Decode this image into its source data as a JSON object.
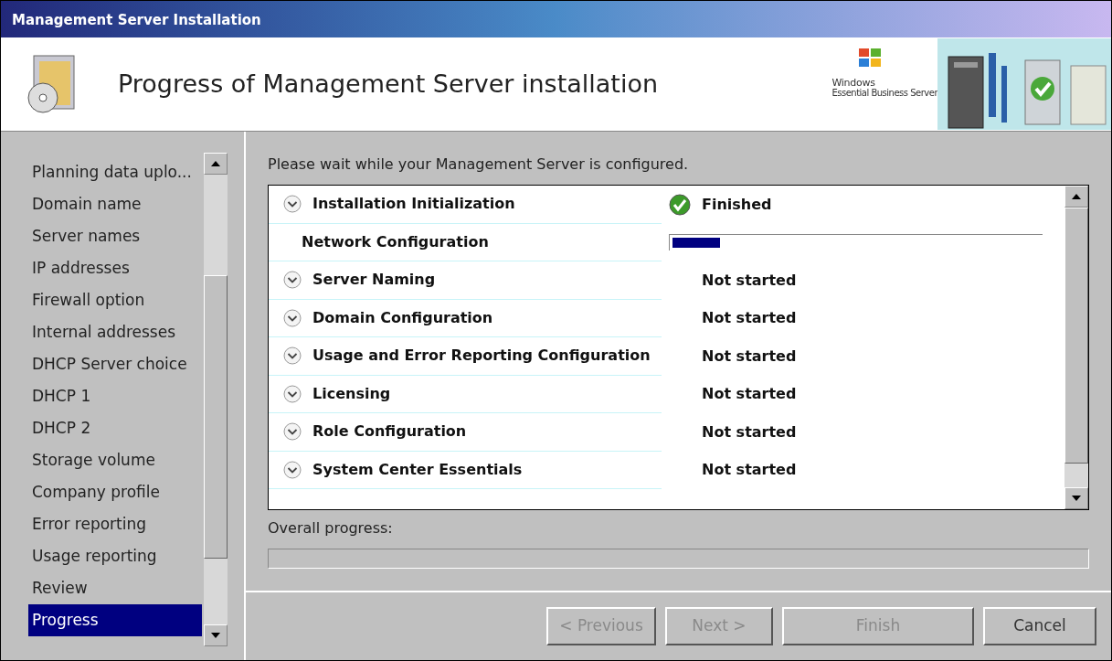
{
  "window": {
    "title": "Management Server Installation"
  },
  "header": {
    "title": "Progress of Management Server installation",
    "logo_line_1": "Windows",
    "logo_line_2": "Essential Business Server"
  },
  "sidebar": {
    "items": [
      {
        "label": "Planning  data uplo...",
        "selected": false
      },
      {
        "label": "Domain name",
        "selected": false
      },
      {
        "label": "Server names",
        "selected": false
      },
      {
        "label": "IP addresses",
        "selected": false
      },
      {
        "label": "Firewall option",
        "selected": false
      },
      {
        "label": "Internal addresses",
        "selected": false
      },
      {
        "label": "DHCP Server choice",
        "selected": false
      },
      {
        "label": "DHCP 1",
        "selected": false
      },
      {
        "label": "DHCP 2",
        "selected": false
      },
      {
        "label": "Storage volume",
        "selected": false
      },
      {
        "label": "Company profile",
        "selected": false
      },
      {
        "label": "Error reporting",
        "selected": false
      },
      {
        "label": "Usage reporting",
        "selected": false
      },
      {
        "label": "Review",
        "selected": false
      },
      {
        "label": "Progress",
        "selected": true
      }
    ]
  },
  "content": {
    "instruction": "Please wait while your Management Server is configured.",
    "tasks": [
      {
        "name": "Installation Initialization",
        "kind": "finished",
        "status": "Finished"
      },
      {
        "name": "Network Configuration",
        "kind": "running",
        "level": 0.13
      },
      {
        "name": "Server Naming",
        "kind": "pending",
        "status": "Not started"
      },
      {
        "name": "Domain Configuration",
        "kind": "pending",
        "status": "Not started"
      },
      {
        "name": "Usage and Error Reporting Configuration",
        "kind": "pending",
        "status": "Not started"
      },
      {
        "name": "Licensing",
        "kind": "pending",
        "status": "Not started"
      },
      {
        "name": "Role Configuration",
        "kind": "pending",
        "status": "Not started"
      },
      {
        "name": "System Center Essentials",
        "kind": "pending",
        "status": "Not started"
      }
    ],
    "overall_progress": {
      "label": "Overall progress:",
      "level": 0
    }
  },
  "buttons": [
    {
      "label": "< Previous",
      "disabled": true
    },
    {
      "label": "Next >",
      "disabled": true
    },
    {
      "label": "Finish",
      "disabled": true
    },
    {
      "label": "Cancel",
      "disabled": false
    }
  ]
}
